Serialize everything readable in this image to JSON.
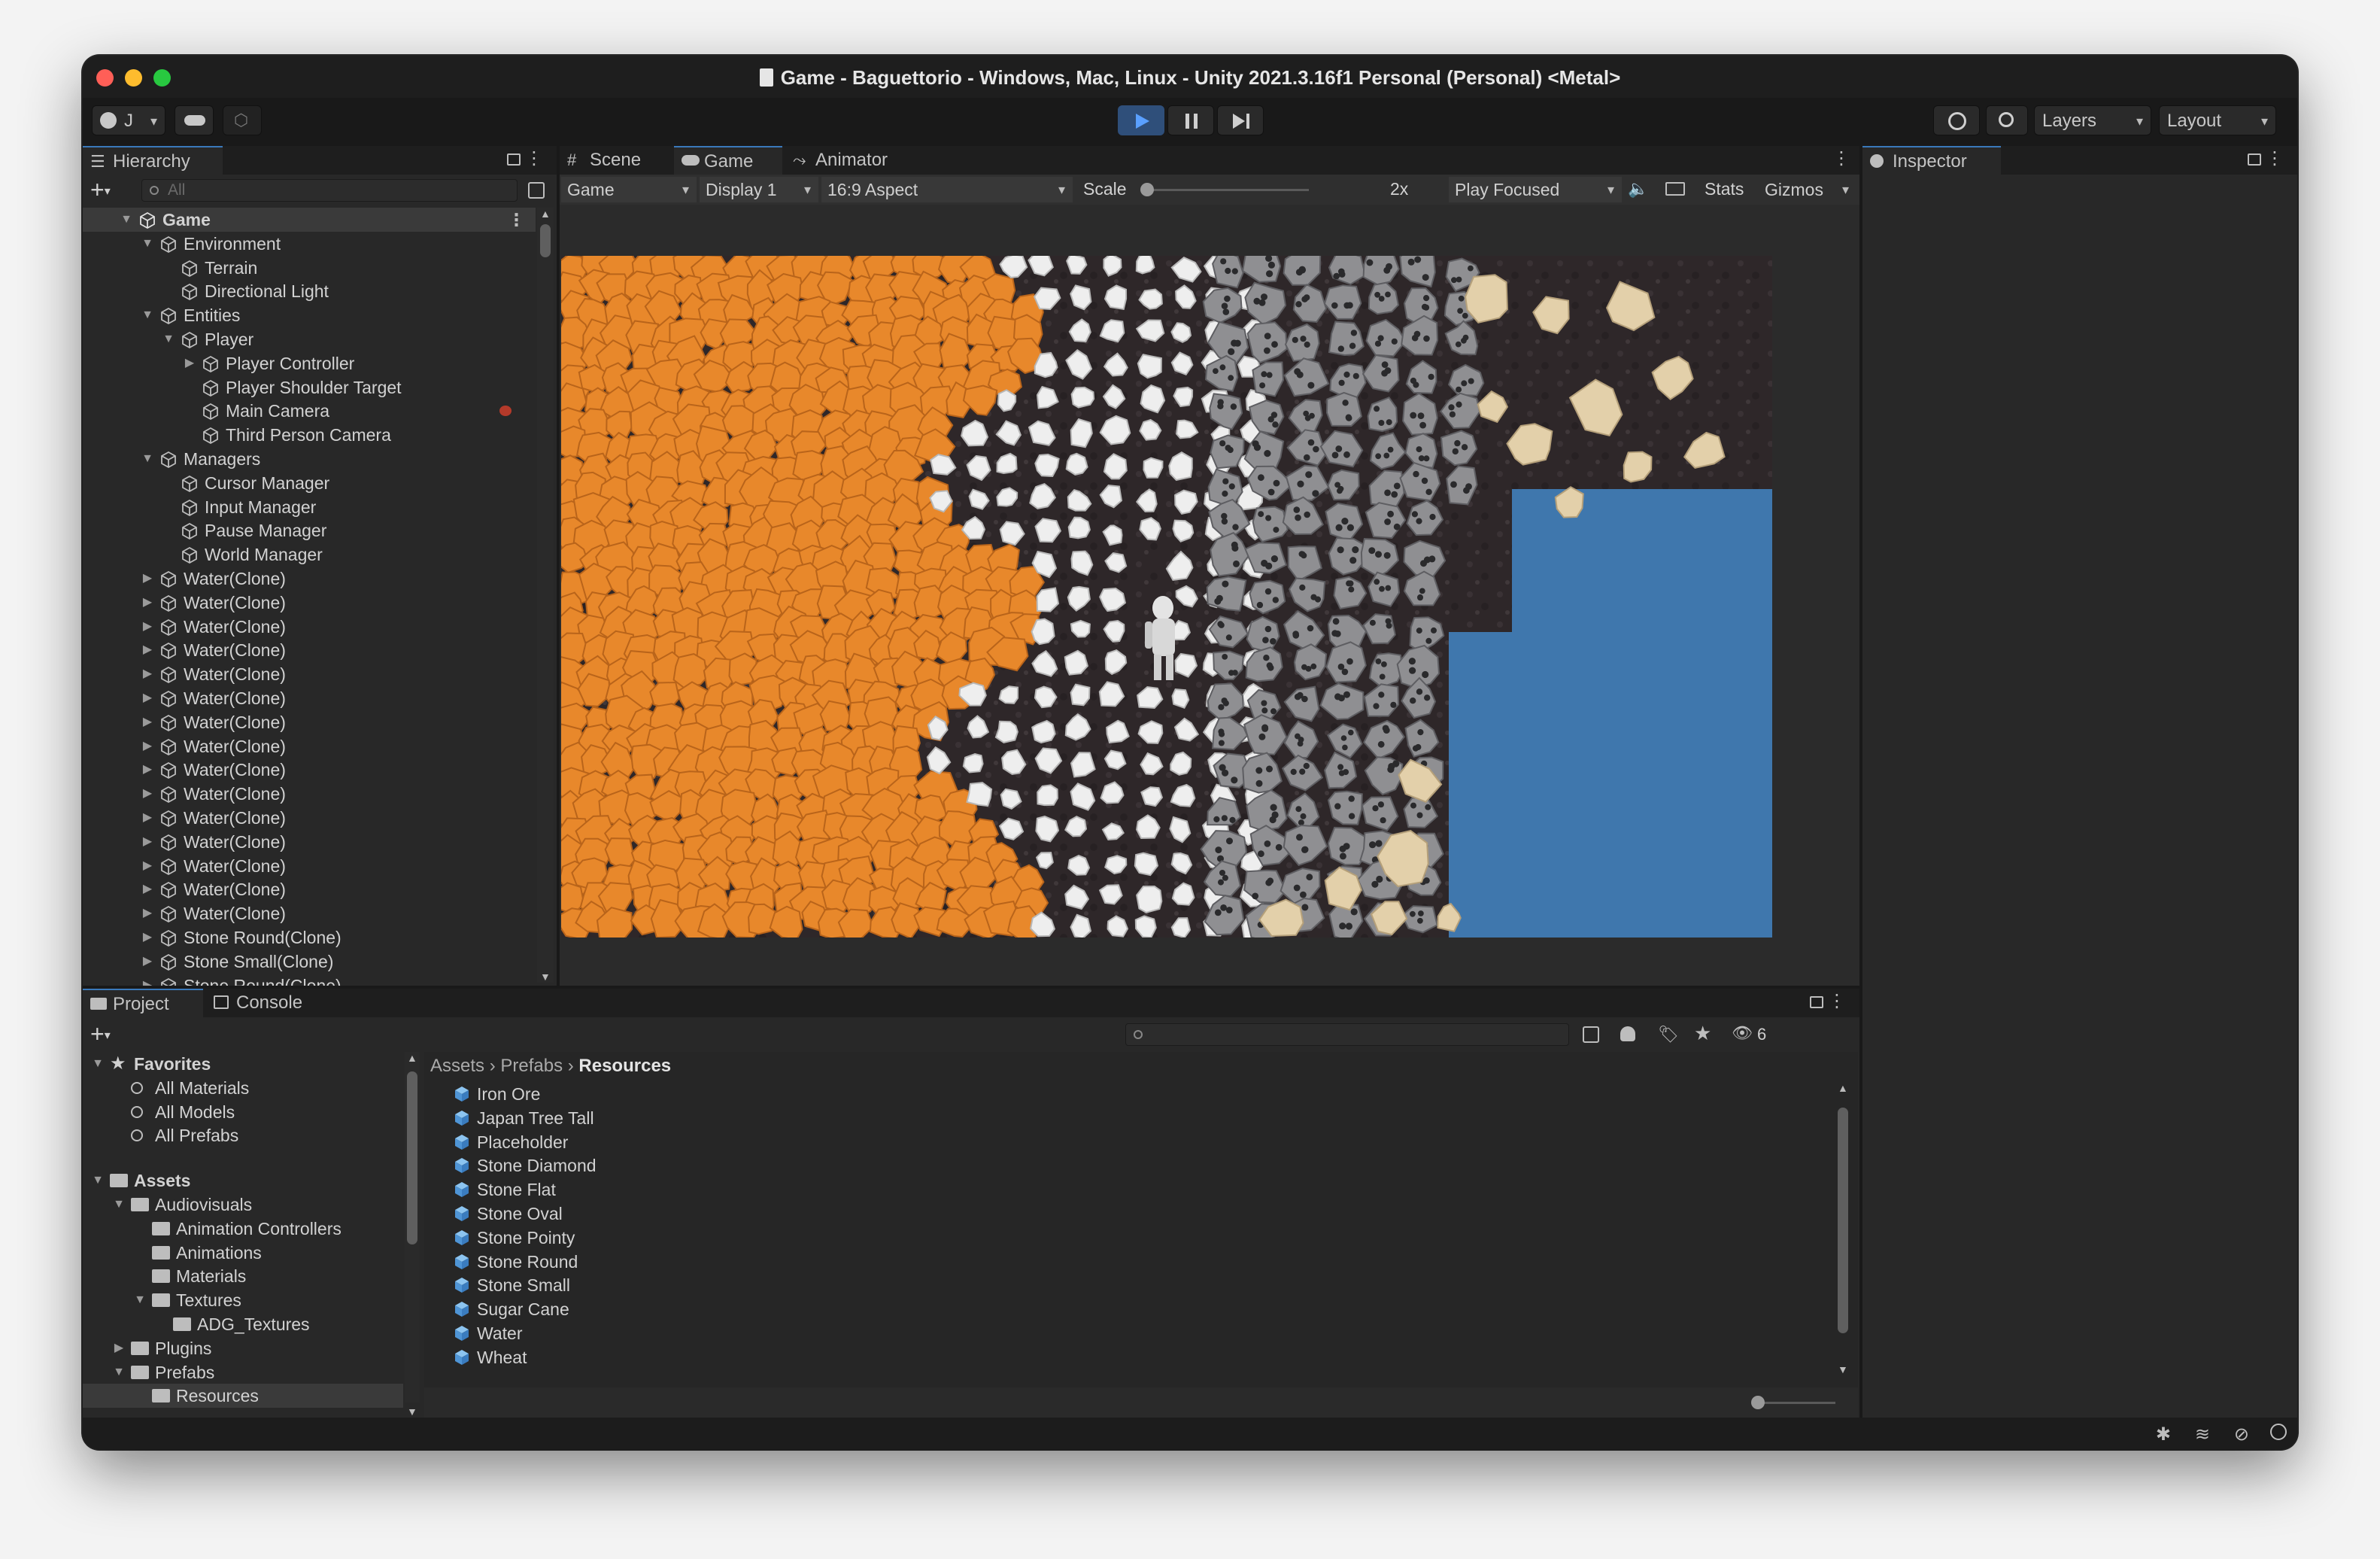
{
  "window": {
    "title": "Game - Baguettorio - Windows, Mac, Linux - Unity 2021.3.16f1 Personal (Personal) <Metal>"
  },
  "colors": {
    "accent": "#3a79bb",
    "play_active": "#4a8ad6",
    "ore": "#e8882b",
    "water": "#3f77ad",
    "highlight": "#3a3a3a"
  },
  "toolbar": {
    "account_label": "J",
    "layers_label": "Layers",
    "layout_label": "Layout"
  },
  "hierarchy": {
    "tab_label": "Hierarchy",
    "search_placeholder": "All",
    "items": [
      {
        "label": "Game",
        "depth": 0,
        "expanded": true,
        "root": true
      },
      {
        "label": "Environment",
        "depth": 1,
        "expanded": true
      },
      {
        "label": "Terrain",
        "depth": 2
      },
      {
        "label": "Directional Light",
        "depth": 2
      },
      {
        "label": "Entities",
        "depth": 1,
        "expanded": true
      },
      {
        "label": "Player",
        "depth": 2,
        "expanded": true
      },
      {
        "label": "Player Controller",
        "depth": 3,
        "collapsed": true
      },
      {
        "label": "Player Shoulder Target",
        "depth": 3
      },
      {
        "label": "Main Camera",
        "depth": 3,
        "badge": true
      },
      {
        "label": "Third Person Camera",
        "depth": 3
      },
      {
        "label": "Managers",
        "depth": 1,
        "expanded": true
      },
      {
        "label": "Cursor Manager",
        "depth": 2
      },
      {
        "label": "Input Manager",
        "depth": 2
      },
      {
        "label": "Pause Manager",
        "depth": 2
      },
      {
        "label": "World Manager",
        "depth": 2
      },
      {
        "label": "Water(Clone)",
        "depth": 1,
        "collapsed": true
      },
      {
        "label": "Water(Clone)",
        "depth": 1,
        "collapsed": true
      },
      {
        "label": "Water(Clone)",
        "depth": 1,
        "collapsed": true
      },
      {
        "label": "Water(Clone)",
        "depth": 1,
        "collapsed": true
      },
      {
        "label": "Water(Clone)",
        "depth": 1,
        "collapsed": true
      },
      {
        "label": "Water(Clone)",
        "depth": 1,
        "collapsed": true
      },
      {
        "label": "Water(Clone)",
        "depth": 1,
        "collapsed": true
      },
      {
        "label": "Water(Clone)",
        "depth": 1,
        "collapsed": true
      },
      {
        "label": "Water(Clone)",
        "depth": 1,
        "collapsed": true
      },
      {
        "label": "Water(Clone)",
        "depth": 1,
        "collapsed": true
      },
      {
        "label": "Water(Clone)",
        "depth": 1,
        "collapsed": true
      },
      {
        "label": "Water(Clone)",
        "depth": 1,
        "collapsed": true
      },
      {
        "label": "Water(Clone)",
        "depth": 1,
        "collapsed": true
      },
      {
        "label": "Water(Clone)",
        "depth": 1,
        "collapsed": true
      },
      {
        "label": "Water(Clone)",
        "depth": 1,
        "collapsed": true
      },
      {
        "label": "Stone Round(Clone)",
        "depth": 1,
        "collapsed": true
      },
      {
        "label": "Stone Small(Clone)",
        "depth": 1,
        "collapsed": true
      },
      {
        "label": "Stone Round(Clone)",
        "depth": 1,
        "collapsed": true
      }
    ]
  },
  "center": {
    "tabs": {
      "scene": "Scene",
      "game": "Game",
      "animator": "Animator"
    },
    "game_toolbar": {
      "view_mode": "Game",
      "display": "Display 1",
      "aspect": "16:9 Aspect",
      "scale_label": "Scale",
      "scale_value": "2x",
      "play_mode": "Play Focused",
      "stats": "Stats",
      "gizmos": "Gizmos"
    }
  },
  "inspector": {
    "tab_label": "Inspector"
  },
  "project": {
    "tabs": {
      "project": "Project",
      "console": "Console"
    },
    "hidden_count": "6",
    "breadcrumb": [
      "Assets",
      "Prefabs",
      "Resources"
    ],
    "favorites": {
      "label": "Favorites",
      "items": [
        "All Materials",
        "All Models",
        "All Prefabs"
      ]
    },
    "tree": [
      {
        "label": "Assets",
        "depth": 0,
        "expanded": true,
        "bold": true
      },
      {
        "label": "Audiovisuals",
        "depth": 1,
        "expanded": true
      },
      {
        "label": "Animation Controllers",
        "depth": 2
      },
      {
        "label": "Animations",
        "depth": 2
      },
      {
        "label": "Materials",
        "depth": 2
      },
      {
        "label": "Textures",
        "depth": 2,
        "expanded": true
      },
      {
        "label": "ADG_Textures",
        "depth": 3
      },
      {
        "label": "Plugins",
        "depth": 1,
        "collapsed": true
      },
      {
        "label": "Prefabs",
        "depth": 1,
        "expanded": true
      },
      {
        "label": "Resources",
        "depth": 2,
        "selected": true
      }
    ],
    "assets": [
      "Iron Ore",
      "Japan Tree Tall",
      "Placeholder",
      "Stone Diamond",
      "Stone Flat",
      "Stone Oval",
      "Stone Pointy",
      "Stone Round",
      "Stone Small",
      "Sugar Cane",
      "Water",
      "Wheat"
    ]
  }
}
